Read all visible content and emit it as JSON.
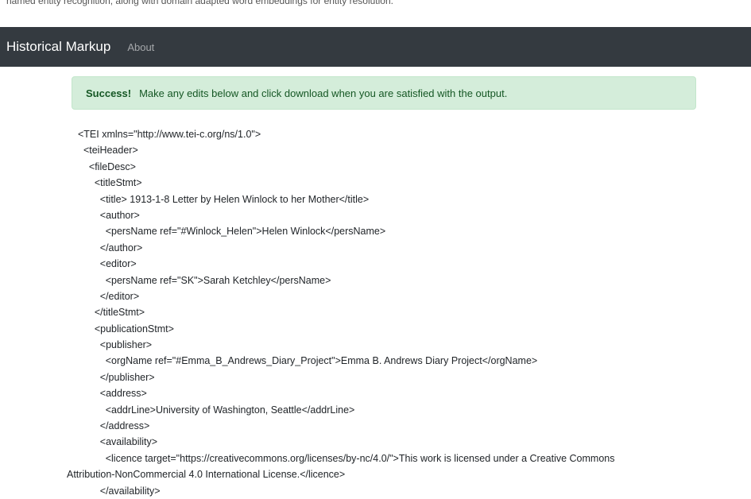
{
  "top_text": "named entity recognition, along with domain adapted word embeddings for entity resolution.",
  "navbar": {
    "brand": "Historical Markup",
    "links": [
      "About"
    ]
  },
  "alert": {
    "strong": "Success!",
    "message": "Make any edits below and click download when you are satisfied with the output."
  },
  "xml_lines": [
    "<TEI xmlns=\"http://www.tei-c.org/ns/1.0\">",
    "  <teiHeader>",
    "    <fileDesc>",
    "      <titleStmt>",
    "        <title> 1913-1-8 Letter by Helen Winlock to her Mother</title>",
    "        <author>",
    "          <persName ref=\"#Winlock_Helen\">Helen Winlock</persName>",
    "        </author>",
    "        <editor>",
    "          <persName ref=\"SK\">Sarah Ketchley</persName>",
    "        </editor>",
    "      </titleStmt>",
    "      <publicationStmt>",
    "        <publisher>",
    "          <orgName ref=\"#Emma_B_Andrews_Diary_Project\">Emma B. Andrews Diary Project</orgName>",
    "        </publisher>",
    "        <address>",
    "          <addrLine>University of Washington, Seattle</addrLine>",
    "        </address>",
    "        <availability>",
    "          <licence target=\"https://creativecommons.org/licenses/by-nc/4.0/\">This work is licensed under a Creative Commons",
    "Attribution-NonCommercial 4.0 International License.</licence>",
    "        </availability>"
  ]
}
